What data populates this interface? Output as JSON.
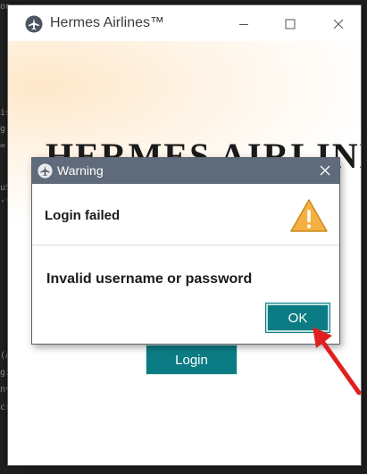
{
  "window": {
    "title": "Hermes Airlines™",
    "headline": "HERMES AIRLINES",
    "login_label": "Login"
  },
  "dialog": {
    "title": "Warning",
    "heading": "Login failed",
    "message": "Invalid username or password",
    "ok_label": "OK"
  },
  "background_code": {
    "fragments": [
      "on",
      "is",
      "g",
      "=",
      "uS",
      "'l",
      "(A",
      "gi",
      "nv",
      "cr"
    ]
  },
  "colors": {
    "accent": "#0c7c84",
    "dialog_titlebar": "#5f6b7a",
    "warning": "#f0a020",
    "annotation_arrow": "#e02020"
  },
  "icons": {
    "app": "airplane-icon",
    "dialog": "airplane-icon",
    "warning": "warning-triangle-icon",
    "annotation": "red-arrow-pointer"
  }
}
